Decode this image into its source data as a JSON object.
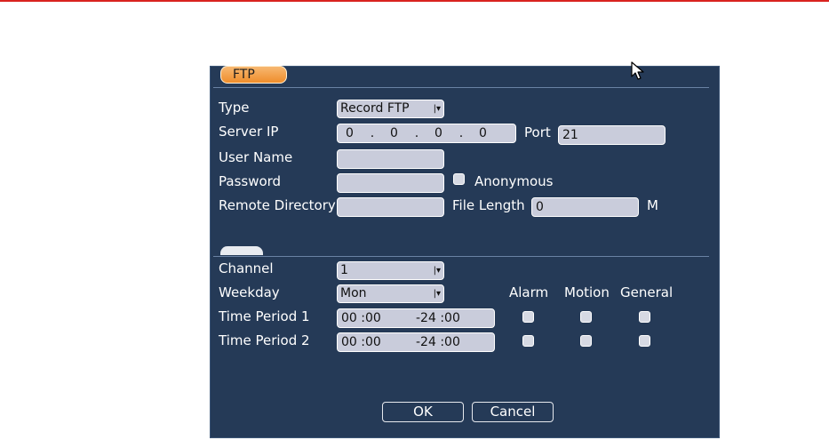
{
  "tab_title": "FTP",
  "form": {
    "type_label": "Type",
    "type_value": "Record FTP",
    "server_ip_label": "Server IP",
    "ip_octets": [
      "0",
      "0",
      "0",
      "0"
    ],
    "port_label": "Port",
    "port_value": "21",
    "user_name_label": "User Name",
    "user_name_value": "",
    "password_label": "Password",
    "password_value": "",
    "anonymous_label": "Anonymous",
    "anonymous_checked": false,
    "remote_directory_label": "Remote Directory",
    "remote_directory_value": "",
    "file_length_label": "File Length",
    "file_length_value": "0",
    "file_length_unit": "M"
  },
  "schedule": {
    "channel_label": "Channel",
    "channel_value": "1",
    "weekday_label": "Weekday",
    "weekday_value": "Mon",
    "col_alarm": "Alarm",
    "col_motion": "Motion",
    "col_general": "General",
    "periods": [
      {
        "label": "Time Period 1",
        "start": "00 :00",
        "end": "-24 :00",
        "alarm": false,
        "motion": false,
        "general": false
      },
      {
        "label": "Time Period 2",
        "start": "00 :00",
        "end": "-24 :00",
        "alarm": false,
        "motion": false,
        "general": false
      }
    ]
  },
  "buttons": {
    "ok": "OK",
    "cancel": "Cancel"
  },
  "colors": {
    "panel_bg": "#253a57",
    "tab_accent": "#ef8d2b",
    "field_bg": "#c9ccdb",
    "top_line": "#d9231f"
  }
}
